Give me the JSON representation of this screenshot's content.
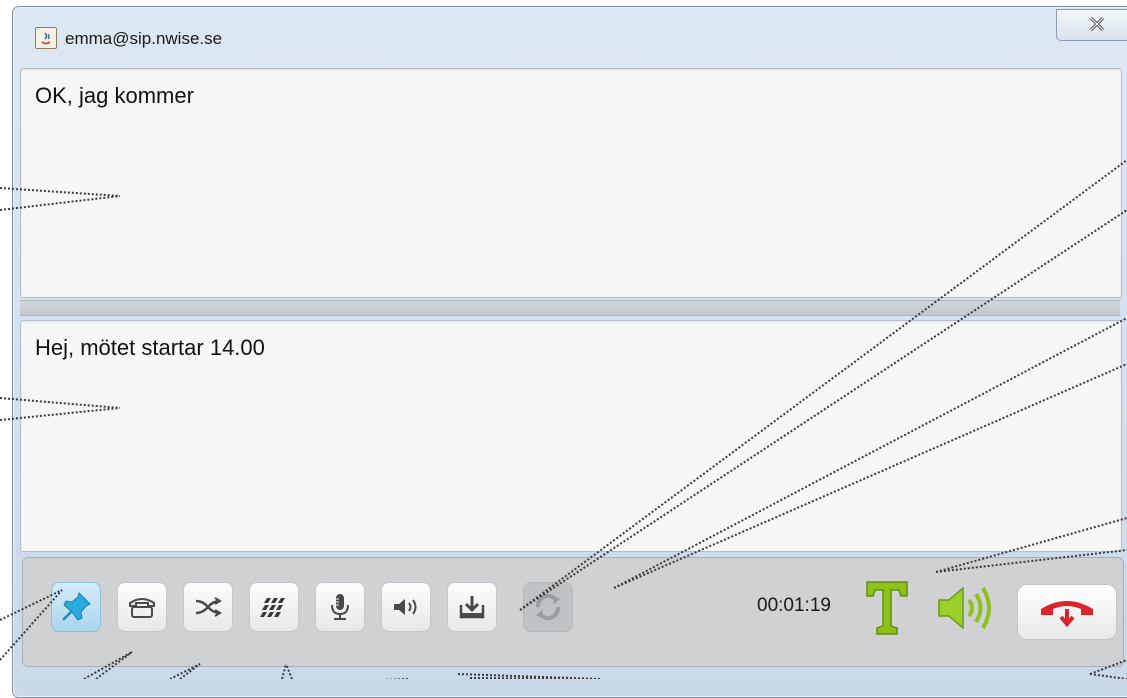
{
  "window": {
    "title": "emma@sip.nwise.se"
  },
  "incoming_panel": {
    "text": "OK, jag kommer"
  },
  "outgoing_panel": {
    "text": "Hej, mötet startar 14.00"
  },
  "toolbar": {
    "buttons": [
      {
        "name": "pin",
        "icon": "pushpin-icon",
        "state": "active"
      },
      {
        "name": "phone",
        "icon": "telephone-icon",
        "state": "normal"
      },
      {
        "name": "split",
        "icon": "split-arrows-icon",
        "state": "normal"
      },
      {
        "name": "dialpad",
        "icon": "dialpad-icon",
        "state": "normal"
      },
      {
        "name": "microphone",
        "icon": "microphone-icon",
        "state": "normal"
      },
      {
        "name": "speaker",
        "icon": "speaker-icon",
        "state": "normal"
      },
      {
        "name": "save",
        "icon": "download-tray-icon",
        "state": "normal"
      },
      {
        "name": "refresh",
        "icon": "refresh-icon",
        "state": "disabled"
      }
    ],
    "timer": "00:01:19",
    "status_icons": [
      "text-mode-icon",
      "audio-active-icon"
    ],
    "hangup_icon": "hangup-icon"
  },
  "colors": {
    "window_bg": "#dde8f4",
    "pin_accent": "#29a9e0",
    "status_green": "#8ec21b",
    "hangup_red": "#d9252b"
  }
}
